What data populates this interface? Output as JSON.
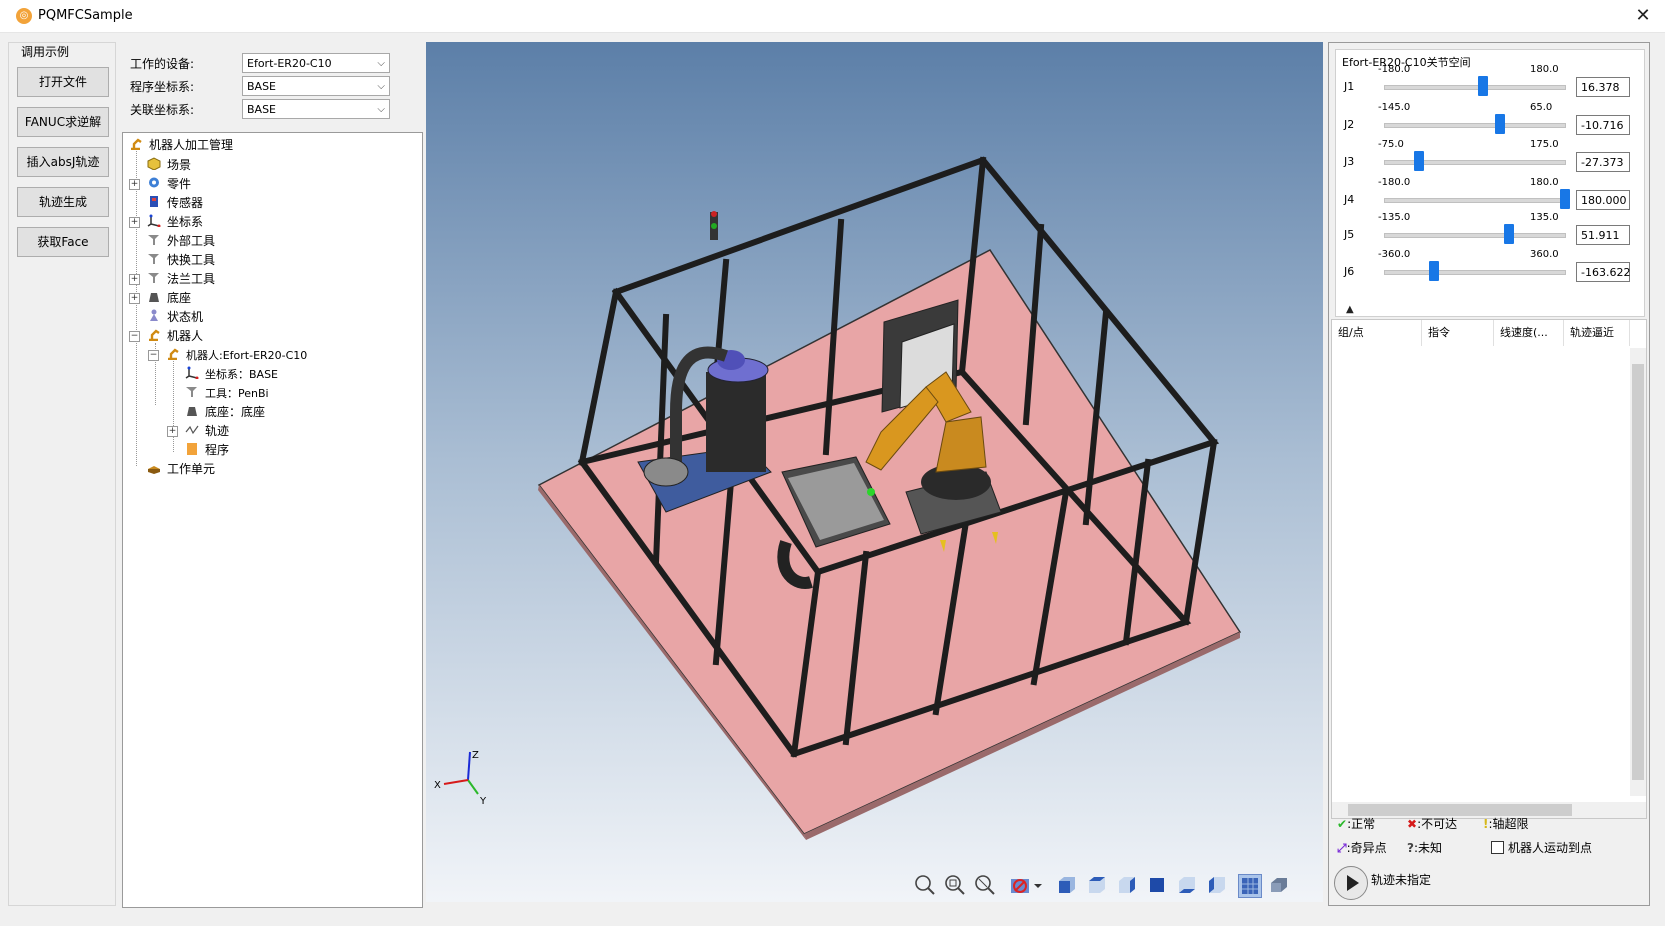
{
  "app": {
    "title": "PQMFCSample",
    "close_glyph": "✕"
  },
  "left_panel": {
    "group_title": "调用示例",
    "buttons": [
      "打开文件",
      "FANUC求逆解",
      "插入absJ轨迹",
      "轨迹生成",
      "获取Face"
    ]
  },
  "settings": {
    "device_label": "工作的设备:",
    "device_value": "Efort-ER20-C10",
    "program_frame_label": "程序坐标系:",
    "program_frame_value": "BASE",
    "linked_frame_label": "关联坐标系:",
    "linked_frame_value": "BASE"
  },
  "tree": {
    "items": [
      {
        "label": "机器人加工管理",
        "icon": "robot-arm-icon"
      },
      {
        "label": "场景",
        "icon": "scene-box-icon"
      },
      {
        "label": "零件",
        "icon": "gear-icon"
      },
      {
        "label": "传感器",
        "icon": "sensor-icon"
      },
      {
        "label": "坐标系",
        "icon": "axes-icon"
      },
      {
        "label": "外部工具",
        "icon": "tool-icon"
      },
      {
        "label": "快换工具",
        "icon": "tool-icon"
      },
      {
        "label": "法兰工具",
        "icon": "tool-icon"
      },
      {
        "label": "底座",
        "icon": "base-icon"
      },
      {
        "label": "状态机",
        "icon": "state-machine-icon"
      },
      {
        "label": "机器人",
        "icon": "robot-arm-icon"
      },
      {
        "label": "机器人:Efort-ER20-C10",
        "icon": "robot-arm-icon"
      },
      {
        "label": "坐标系：BASE",
        "icon": "axes-icon"
      },
      {
        "label": "工具：PenBi",
        "icon": "tool-icon"
      },
      {
        "label": "底座：底座",
        "icon": "base-icon"
      },
      {
        "label": "轨迹",
        "icon": "path-icon"
      },
      {
        "label": "程序",
        "icon": "program-icon"
      },
      {
        "label": "工作单元",
        "icon": "workcell-icon"
      }
    ]
  },
  "joints": {
    "title": "Efort-ER20-C10关节空间",
    "items": [
      {
        "name": "J1",
        "min": "-180.0",
        "max": "180.0",
        "value": "16.378",
        "fraction": 0.545
      },
      {
        "name": "J2",
        "min": "-145.0",
        "max": "65.0",
        "value": "-10.716",
        "fraction": 0.64
      },
      {
        "name": "J3",
        "min": "-75.0",
        "max": "175.0",
        "value": "-27.373",
        "fraction": 0.19
      },
      {
        "name": "J4",
        "min": "-180.0",
        "max": "180.0",
        "value": "180.000",
        "fraction": 1.0
      },
      {
        "name": "J5",
        "min": "-135.0",
        "max": "135.0",
        "value": "51.911",
        "fraction": 0.69
      },
      {
        "name": "J6",
        "min": "-360.0",
        "max": "360.0",
        "value": "-163.622",
        "fraction": 0.27
      }
    ]
  },
  "program_table": {
    "columns": [
      "组/点",
      "指令",
      "线速度(...",
      "轨迹逼近"
    ]
  },
  "legend": {
    "normal": ":正常",
    "unreachable": ":不可达",
    "axis_limit": ":轴超限",
    "singular": ":奇异点",
    "unknown": ":未知",
    "robot_move_label": "机器人运动到点",
    "path_status": "轨迹未指定"
  },
  "axis_triad": {
    "z": "Z",
    "y": "Y",
    "x": "X"
  },
  "colors": {
    "floor": "#e8a5a6",
    "frame": "#1d1d1d",
    "robot": "#c98a1f",
    "slider_thumb": "#1877e6",
    "viewport_top": "#5c7fa8"
  }
}
